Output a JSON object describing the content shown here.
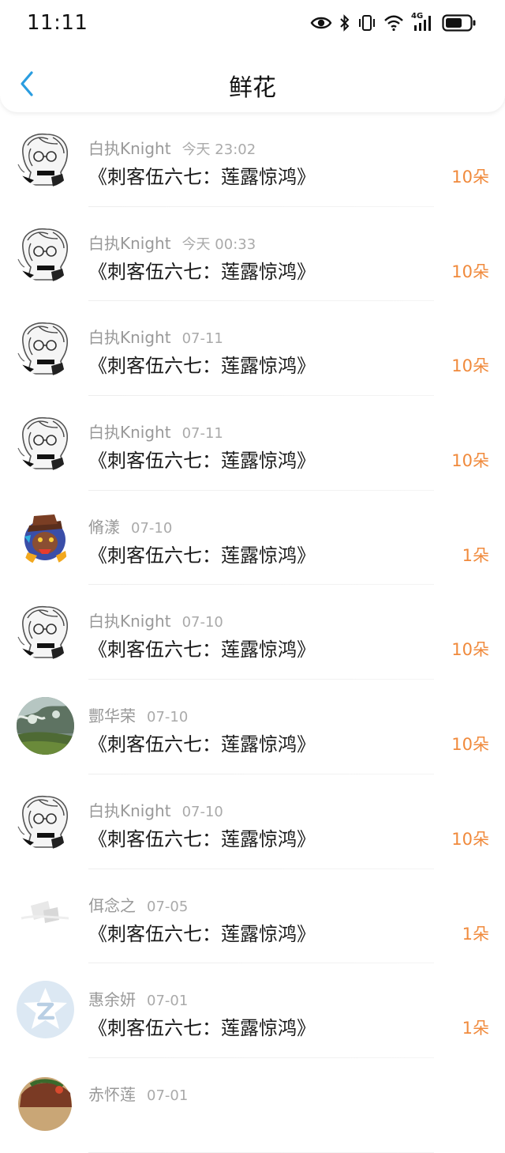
{
  "status_bar": {
    "time": "11:11",
    "icons": [
      "eye-icon",
      "bluetooth-icon",
      "vibrate-icon",
      "wifi-icon",
      "signal-4g-icon",
      "battery-icon"
    ],
    "network_label": "4G"
  },
  "header": {
    "title": "鲜花",
    "back_icon": "chevron-left-icon",
    "accent_color": "#2a9de0"
  },
  "flower_count_color": "#f08a3c",
  "gifts": [
    {
      "user": "白执Knight",
      "date": "今天 23:02",
      "work": "《刺客伍六七：莲露惊鸿》",
      "amount": "10朵",
      "avatar": "anime-sketch"
    },
    {
      "user": "白执Knight",
      "date": "今天 00:33",
      "work": "《刺客伍六七：莲露惊鸿》",
      "amount": "10朵",
      "avatar": "anime-sketch"
    },
    {
      "user": "白执Knight",
      "date": "07-11",
      "work": "《刺客伍六七：莲露惊鸿》",
      "amount": "10朵",
      "avatar": "anime-sketch"
    },
    {
      "user": "白执Knight",
      "date": "07-11",
      "work": "《刺客伍六七：莲露惊鸿》",
      "amount": "10朵",
      "avatar": "anime-sketch"
    },
    {
      "user": "脩漾",
      "date": "07-10",
      "work": "《刺客伍六七：莲露惊鸿》",
      "amount": "1朵",
      "avatar": "colorful-character"
    },
    {
      "user": "白执Knight",
      "date": "07-10",
      "work": "《刺客伍六七：莲露惊鸿》",
      "amount": "10朵",
      "avatar": "anime-sketch"
    },
    {
      "user": "酆华荣",
      "date": "07-10",
      "work": "《刺客伍六七：莲露惊鸿》",
      "amount": "10朵",
      "avatar": "landscape"
    },
    {
      "user": "白执Knight",
      "date": "07-10",
      "work": "《刺客伍六七：莲露惊鸿》",
      "amount": "10朵",
      "avatar": "anime-sketch"
    },
    {
      "user": "佴念之",
      "date": "07-05",
      "work": "《刺客伍六七：莲露惊鸿》",
      "amount": "1朵",
      "avatar": "faded-white"
    },
    {
      "user": "惠余妍",
      "date": "07-01",
      "work": "《刺客伍六七：莲露惊鸿》",
      "amount": "1朵",
      "avatar": "default-z"
    },
    {
      "user": "赤怀莲",
      "date": "07-01",
      "work": "",
      "amount": "",
      "avatar": "partial-colorful"
    }
  ]
}
